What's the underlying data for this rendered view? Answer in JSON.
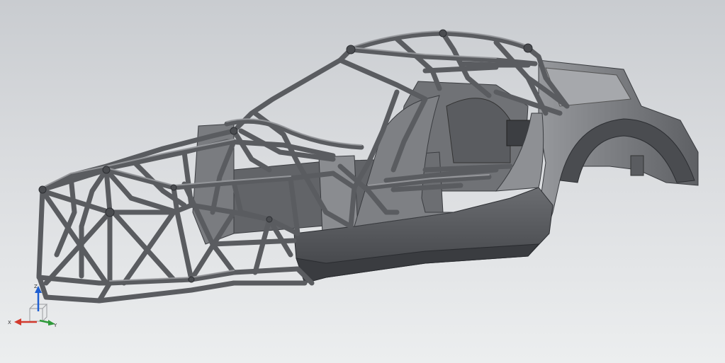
{
  "viewport": {
    "background_top": "#c9ccd0",
    "background_bottom": "#eceeef"
  },
  "model": {
    "icon": "tube-frame-chassis-render",
    "colors": {
      "tube": "#5a5c60",
      "tube_highlight": "#9a9ca0",
      "panel_light": "#8e9094",
      "panel_mid": "#6b6d71",
      "panel_dark": "#3e4044"
    }
  },
  "triad": {
    "x_label": "X",
    "y_label": "Y",
    "z_label": "Z",
    "colors": {
      "x": "#d23a2e",
      "y": "#2f9a3a",
      "z": "#1f5fd1"
    }
  }
}
